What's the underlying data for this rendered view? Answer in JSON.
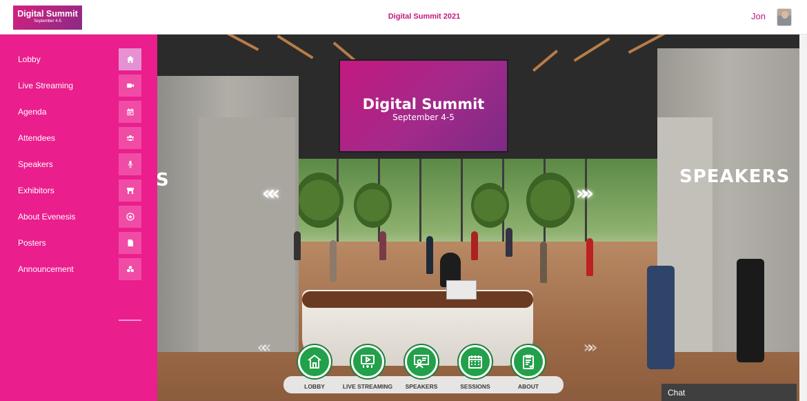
{
  "header": {
    "logo_title": "Digital Summit",
    "logo_subtitle": "September 4-5",
    "event_title": "Digital Summit 2021",
    "user_name": "Jon"
  },
  "sidebar": {
    "active_color": "#e591d3",
    "background_color": "#ea1e8c",
    "items": [
      {
        "label": "Lobby",
        "icon": "home-icon"
      },
      {
        "label": "Live Streaming",
        "icon": "video-camera-icon"
      },
      {
        "label": "Agenda",
        "icon": "calendar-icon"
      },
      {
        "label": "Attendees",
        "icon": "users-icon"
      },
      {
        "label": "Speakers",
        "icon": "microphone-icon"
      },
      {
        "label": "Exhibitors",
        "icon": "booth-icon"
      },
      {
        "label": "About Evenesis",
        "icon": "badge-icon"
      },
      {
        "label": "Posters",
        "icon": "file-icon"
      },
      {
        "label": "Announcement",
        "icon": "announcement-icon"
      }
    ]
  },
  "scene": {
    "screen_title": "Digital Summit",
    "screen_subtitle": "September 4-5",
    "right_sign": "SPEAKERS",
    "left_sign_partial": "S",
    "arrow_left": "««",
    "arrow_right": "»»"
  },
  "dock": {
    "items": [
      {
        "label": "LOBBY",
        "icon": "lobby-building-icon"
      },
      {
        "label": "LIVE STREAMING",
        "icon": "stream-screen-icon"
      },
      {
        "label": "SPEAKERS",
        "icon": "presenter-icon"
      },
      {
        "label": "SESSIONS",
        "icon": "calendar-grid-icon"
      },
      {
        "label": "ABOUT",
        "icon": "clipboard-check-icon"
      }
    ],
    "accent_color": "#22a04a"
  },
  "chat": {
    "label": "Chat"
  }
}
